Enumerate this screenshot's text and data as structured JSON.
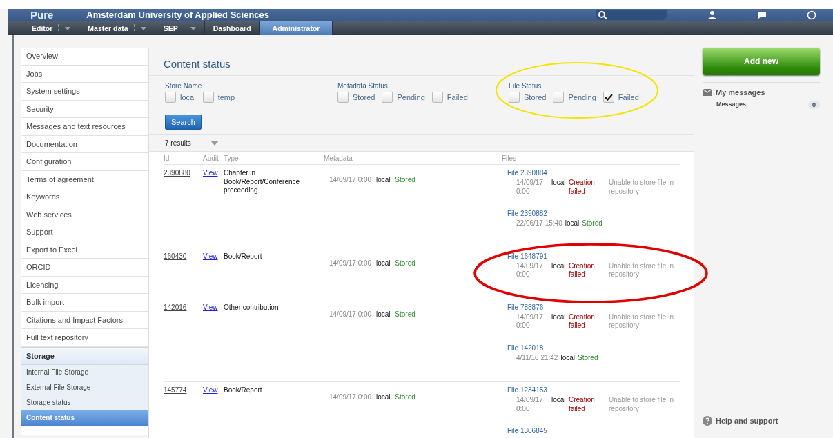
{
  "header": {
    "logo": "Pure",
    "title": "Amsterdam University of Applied Sciences"
  },
  "nav": [
    {
      "label": "Editor",
      "dropdown": true,
      "selected": false
    },
    {
      "label": "Master data",
      "dropdown": true,
      "selected": false
    },
    {
      "label": "SEP",
      "dropdown": true,
      "selected": false
    },
    {
      "label": "Dashboard",
      "dropdown": false,
      "selected": false
    },
    {
      "label": "Administrator",
      "dropdown": false,
      "selected": true
    }
  ],
  "sidebar": {
    "items": [
      {
        "label": "Overview",
        "selected": false
      },
      {
        "label": "Jobs",
        "selected": false
      },
      {
        "label": "System settings",
        "selected": false
      },
      {
        "label": "Security",
        "selected": false
      },
      {
        "label": "Messages and text resources",
        "selected": false
      },
      {
        "label": "Documentation",
        "selected": false
      },
      {
        "label": "Configuration",
        "selected": false
      },
      {
        "label": "Terms of agreement",
        "selected": false
      },
      {
        "label": "Keywords",
        "selected": false
      },
      {
        "label": "Web services",
        "selected": false
      },
      {
        "label": "Support",
        "selected": false
      },
      {
        "label": "Export to Excel",
        "selected": false
      },
      {
        "label": "ORCID",
        "selected": false
      },
      {
        "label": "Licensing",
        "selected": false
      },
      {
        "label": "Bulk import",
        "selected": false
      },
      {
        "label": "Citations and Impact Factors",
        "selected": false
      },
      {
        "label": "Full text repository",
        "selected": false
      }
    ],
    "section": {
      "label": "Storage",
      "children": [
        {
          "label": "Internal File Storage",
          "selected": false
        },
        {
          "label": "External File Storage",
          "selected": false
        },
        {
          "label": "Storage status",
          "selected": false
        },
        {
          "label": "Content status",
          "selected": true
        }
      ]
    }
  },
  "main": {
    "title": "Content status",
    "filters": [
      {
        "label": "Store Name",
        "options": [
          {
            "label": "local",
            "checked": false
          },
          {
            "label": "temp",
            "checked": false
          }
        ]
      },
      {
        "label": "Metadata Status",
        "options": [
          {
            "label": "Stored",
            "checked": false
          },
          {
            "label": "Pending",
            "checked": false
          },
          {
            "label": "Failed",
            "checked": false
          }
        ]
      },
      {
        "label": "File Status",
        "options": [
          {
            "label": "Stored",
            "checked": false
          },
          {
            "label": "Pending",
            "checked": false
          },
          {
            "label": "Failed",
            "checked": true
          }
        ]
      }
    ],
    "search_button": "Search",
    "results": "7 results",
    "columns": [
      "Id",
      "Audit",
      "Type",
      "Metadata",
      "Files"
    ],
    "rows": [
      {
        "id": "2390880",
        "audit": "View",
        "type": "Chapter in Book/Report/Conference proceeding",
        "metadata": {
          "date": "14/09/17 0:00",
          "store": "local",
          "status": "Stored",
          "kind": "stored"
        },
        "files": [
          {
            "name": "File 2390884",
            "date": "14/09/17 0:00",
            "store": "local",
            "status": "Creation failed",
            "kind": "failed",
            "message": "Unable to store file in repository"
          },
          {
            "name": "File 2390882",
            "date": "22/06/17 15:40",
            "store": "local",
            "status": "Stored",
            "kind": "stored"
          }
        ]
      },
      {
        "id": "160430",
        "audit": "View",
        "type": "Book/Report",
        "metadata": {
          "date": "14/09/17 0:00",
          "store": "local",
          "status": "Stored",
          "kind": "stored"
        },
        "files": [
          {
            "name": "File 1648791",
            "date": "14/09/17 0:00",
            "store": "local",
            "status": "Creation failed",
            "kind": "failed",
            "message": "Unable to store file in repository"
          }
        ]
      },
      {
        "id": "142016",
        "audit": "View",
        "type": "Other contribution",
        "metadata": {
          "date": "14/09/17 0:00",
          "store": "local",
          "status": "Stored",
          "kind": "stored"
        },
        "files": [
          {
            "name": "File 788876",
            "date": "14/09/17 0:00",
            "store": "local",
            "status": "Creation failed",
            "kind": "failed",
            "message": "Unable to store file in repository"
          },
          {
            "name": "File 142018",
            "date": "4/11/16 21:42",
            "store": "local",
            "status": "Stored",
            "kind": "stored"
          }
        ]
      },
      {
        "id": "145774",
        "audit": "View",
        "type": "Book/Report",
        "metadata": {
          "date": "14/09/17 0:00",
          "store": "local",
          "status": "Stored",
          "kind": "stored"
        },
        "files": [
          {
            "name": "File 1234153",
            "date": "14/09/17 0:00",
            "store": "local",
            "status": "Creation failed",
            "kind": "failed",
            "message": "Unable to store file in repository"
          },
          {
            "name": "File 1306845",
            "kind": "cut"
          }
        ]
      }
    ]
  },
  "aside": {
    "add_button": "Add new",
    "messages_title": "My messages",
    "messages_label": "Messages",
    "messages_count": "0",
    "help": "Help and support"
  }
}
